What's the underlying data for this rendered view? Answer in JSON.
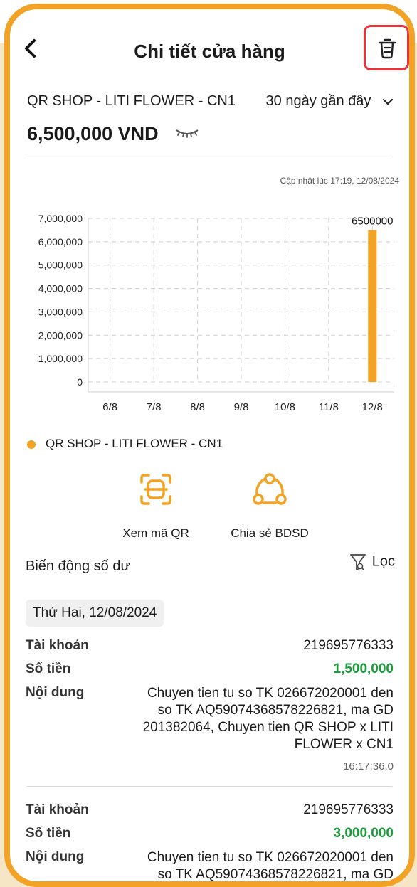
{
  "header": {
    "title": "Chi tiết cửa hàng",
    "back_icon": "chevron-left-icon",
    "delete_icon": "trash-icon",
    "delete_highlight_color": "#e8323c"
  },
  "store": {
    "name": "QR SHOP - LITI FLOWER - CN1",
    "range": "30 ngày gần đây",
    "balance": "6,500,000 VND",
    "updated": "Cập nhật lúc 17:19, 12/08/2024"
  },
  "colors": {
    "accent": "#f2a224",
    "money": "#1a9c3a"
  },
  "chart_data": {
    "type": "bar",
    "categories": [
      "6/8",
      "7/8",
      "8/8",
      "9/8",
      "10/8",
      "11/8",
      "12/8"
    ],
    "series": [
      {
        "name": "QR SHOP - LITI FLOWER - CN1",
        "values": [
          0,
          0,
          0,
          0,
          0,
          0,
          6500000
        ]
      }
    ],
    "y_ticks": [
      "0",
      "1,000,000",
      "2,000,000",
      "3,000,000",
      "4,000,000",
      "5,000,000",
      "6,000,000",
      "7,000,000"
    ],
    "ylim": [
      0,
      7000000
    ],
    "data_label": "6500000",
    "grid": true,
    "legend": "bottom-left"
  },
  "actions": {
    "qr_label": "Xem mã QR",
    "share_label": "Chia sẻ BDSD"
  },
  "history": {
    "title": "Biến động số dư",
    "filter_label": "Lọc",
    "date": "Thứ Hai, 12/08/2024",
    "labels": {
      "account": "Tài khoản",
      "amount": "Số tiền",
      "content": "Nội dung"
    },
    "transactions": [
      {
        "account": "219695776333",
        "amount": "1,500,000",
        "content": "Chuyen tien tu so TK 026672020001 den so TK AQ59074368578226821, ma GD 201382064, Chuyen tien QR SHOP x LITI FLOWER x CN1",
        "time": "16:17:36.0"
      },
      {
        "account": "219695776333",
        "amount": "3,000,000",
        "content": "Chuyen tien tu so TK 026672020001 den so TK AQ59074368578226821, ma GD"
      }
    ]
  }
}
